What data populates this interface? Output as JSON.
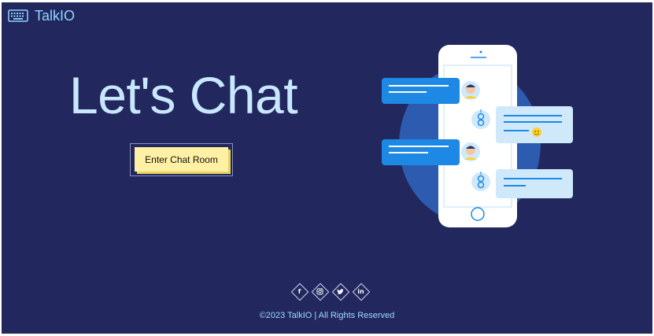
{
  "header": {
    "brand_name": "TalkIO",
    "logo_icon": "keyboard-icon"
  },
  "hero": {
    "title": "Let's Chat",
    "cta_label": "Enter Chat Room"
  },
  "illustration": {
    "description_icon": "phone-chat-illustration-icon",
    "colors": {
      "phone": "#ffffff",
      "circle": "#2c5bb0",
      "bubble_dark": "#1e88e5",
      "bubble_light": "#cfe9fb"
    }
  },
  "social": {
    "items": [
      {
        "icon": "facebook-icon",
        "glyph": "f"
      },
      {
        "icon": "instagram-icon",
        "glyph": ""
      },
      {
        "icon": "twitter-icon",
        "glyph": ""
      },
      {
        "icon": "linkedin-icon",
        "glyph": "in"
      }
    ]
  },
  "footer": {
    "copyright": "©2023 TalkIO | All Rights Reserved"
  },
  "colors": {
    "background": "#22285e",
    "title": "#c9e8ff",
    "cta": "#fff0a3",
    "footer_text": "#9fd8ff"
  }
}
